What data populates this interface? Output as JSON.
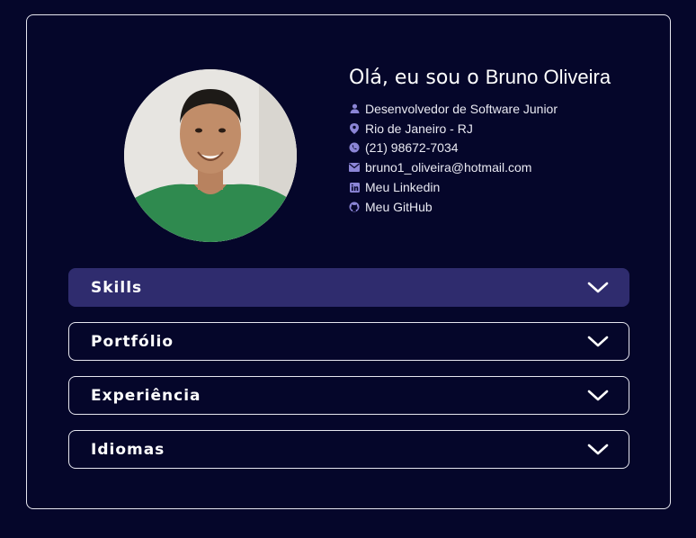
{
  "profile": {
    "greeting_prefix": "Olá, eu sou o",
    "name": "Bruno Oliveira",
    "photo_alt": "Foto de Bruno Oliveira"
  },
  "info": [
    {
      "icon": "user-icon",
      "text": "Desenvolvedor de Software Junior"
    },
    {
      "icon": "map-pin-icon",
      "text": "Rio de Janeiro - RJ"
    },
    {
      "icon": "whatsapp-icon",
      "text": "(21) 98672-7034"
    },
    {
      "icon": "envelope-icon",
      "text": "bruno1_oliveira@hotmail.com"
    },
    {
      "icon": "linkedin-icon",
      "text": "Meu Linkedin"
    },
    {
      "icon": "github-icon",
      "text": "Meu GitHub"
    }
  ],
  "sections": [
    {
      "label": "Skills",
      "expanded_style": true
    },
    {
      "label": "Portfólio",
      "expanded_style": false
    },
    {
      "label": "Experiência",
      "expanded_style": false
    },
    {
      "label": "Idiomas",
      "expanded_style": false
    }
  ],
  "colors": {
    "background": "#05062a",
    "active_section": "#2f2c6e",
    "icon": "#8b85d6",
    "text": "#ffffff"
  }
}
